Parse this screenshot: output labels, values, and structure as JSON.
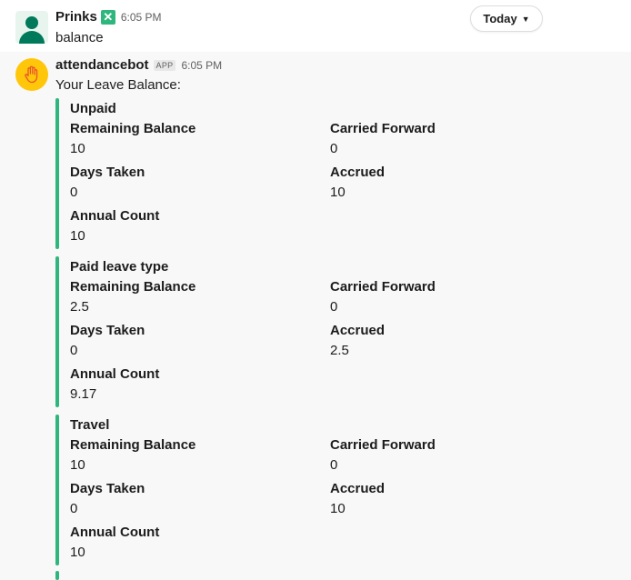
{
  "messages": {
    "user": {
      "name": "Prinks",
      "time": "6:05 PM",
      "text": "balance"
    },
    "date_pill": "Today",
    "bot": {
      "name": "attendancebot",
      "badge": "APP",
      "time": "6:05 PM",
      "intro": "Your Leave Balance:"
    }
  },
  "leave_types": [
    {
      "title": "Unpaid",
      "remaining_label": "Remaining Balance",
      "remaining": "10",
      "carried_label": "Carried Forward",
      "carried": "0",
      "taken_label": "Days Taken",
      "taken": "0",
      "accrued_label": "Accrued",
      "accrued": "10",
      "annual_label": "Annual Count",
      "annual": "10"
    },
    {
      "title": "Paid leave type",
      "remaining_label": "Remaining Balance",
      "remaining": "2.5",
      "carried_label": "Carried Forward",
      "carried": "0",
      "taken_label": "Days Taken",
      "taken": "0",
      "accrued_label": "Accrued",
      "accrued": "2.5",
      "annual_label": "Annual Count",
      "annual": "9.17"
    },
    {
      "title": "Travel",
      "remaining_label": "Remaining Balance",
      "remaining": "10",
      "carried_label": "Carried Forward",
      "carried": "0",
      "taken_label": "Days Taken",
      "taken": "0",
      "accrued_label": "Accrued",
      "accrued": "10",
      "annual_label": "Annual Count",
      "annual": "10"
    }
  ],
  "colors": {
    "accent_bar": "#2eb67d",
    "verified": "#2eb67d",
    "bot_avatar": "#ffc60a"
  }
}
